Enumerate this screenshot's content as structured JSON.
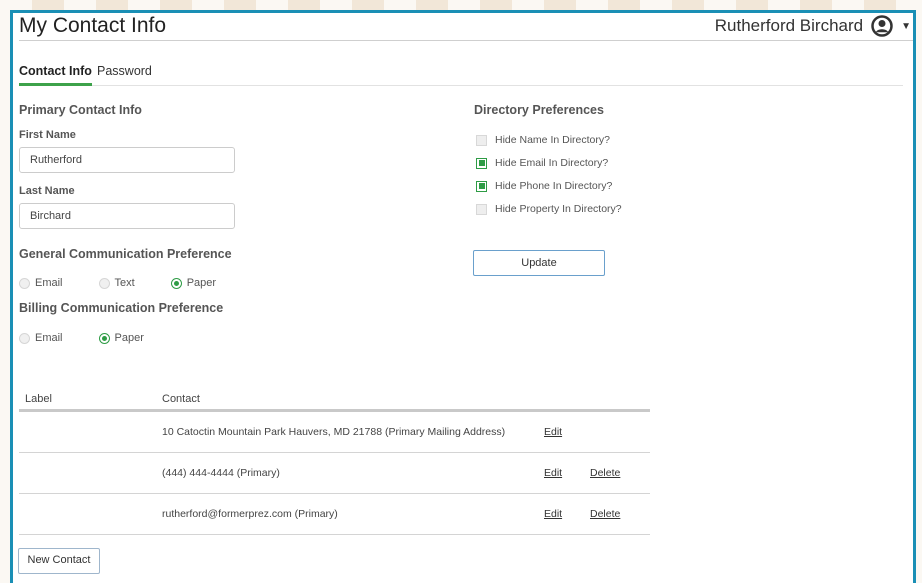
{
  "header": {
    "title": "My Contact Info",
    "user_name": "Rutherford Birchard",
    "avatar_icon": "user-circle-icon",
    "menu_icon": "caret-down-icon"
  },
  "tabs": [
    {
      "label": "Contact Info",
      "active": true
    },
    {
      "label": "Password",
      "active": false
    }
  ],
  "primary": {
    "heading": "Primary Contact Info",
    "first_name_label": "First Name",
    "first_name_value": "Rutherford",
    "last_name_label": "Last Name",
    "last_name_value": "Birchard"
  },
  "general_comm": {
    "heading": "General Communication Preference",
    "options": [
      {
        "label": "Email",
        "selected": false
      },
      {
        "label": "Text",
        "selected": false
      },
      {
        "label": "Paper",
        "selected": true
      }
    ]
  },
  "billing_comm": {
    "heading": "Billing Communication Preference",
    "options": [
      {
        "label": "Email",
        "selected": false
      },
      {
        "label": "Paper",
        "selected": true
      }
    ]
  },
  "directory": {
    "heading": "Directory Preferences",
    "items": [
      {
        "label": "Hide Name In Directory?",
        "checked": false
      },
      {
        "label": "Hide Email In Directory?",
        "checked": true
      },
      {
        "label": "Hide Phone In Directory?",
        "checked": true
      },
      {
        "label": "Hide Property In Directory?",
        "checked": false
      }
    ],
    "update_label": "Update"
  },
  "contacts_table": {
    "columns": [
      "Label",
      "Contact"
    ],
    "rows": [
      {
        "label": "",
        "contact": "10 Catoctin Mountain Park Hauvers, MD 21788 (Primary Mailing Address)",
        "edit": "Edit",
        "delete": ""
      },
      {
        "label": "",
        "contact": "(444) 444-4444 (Primary)",
        "edit": "Edit",
        "delete": "Delete"
      },
      {
        "label": "",
        "contact": "rutherford@formerprez.com (Primary)",
        "edit": "Edit",
        "delete": "Delete"
      }
    ]
  },
  "new_contact_label": "New Contact",
  "colors": {
    "frame": "#1a8fb5",
    "accent_green": "#2e9c45",
    "button_border": "#6aa0cc"
  }
}
